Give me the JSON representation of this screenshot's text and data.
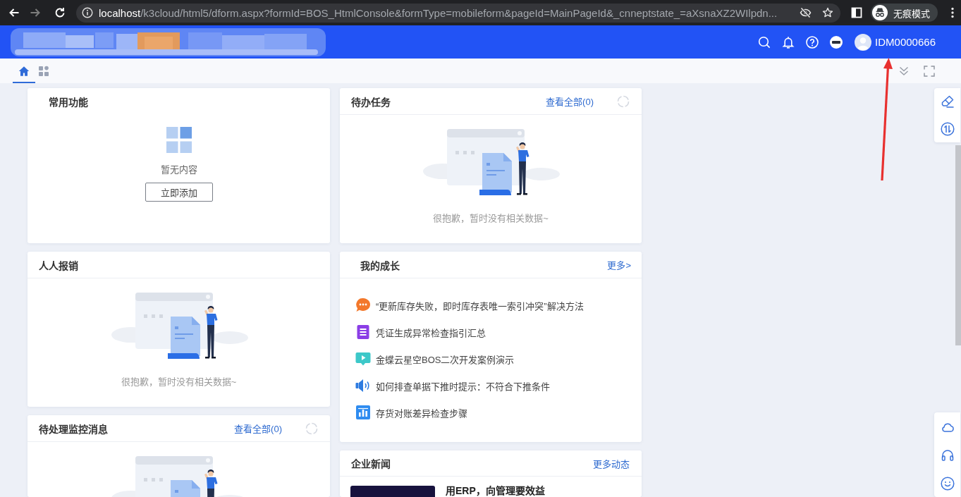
{
  "browser": {
    "address": {
      "host": "localhost",
      "path": "/k3cloud/html5/dform.aspx?formId=BOS_HtmlConsole&formType=mobileform&pageId=MainPageId&_cnneptstate_=aXsnaXZ2WIlpdn..."
    },
    "profile": "无痕模式"
  },
  "header": {
    "username": "IDM0000666"
  },
  "tabs": [
    {
      "kind": "home",
      "selected": true
    },
    {
      "kind": "apps",
      "selected": false
    }
  ],
  "columns": [
    {
      "cards": [
        {
          "kind": "shortcuts",
          "title": "常用功能",
          "loading": false,
          "empty_text": "暂无内容",
          "button": "立即添加"
        },
        {
          "kind": "empty",
          "title": "人人报销",
          "loading": false,
          "message": "很抱歉，暂时没有相关数据~"
        },
        {
          "kind": "empty",
          "title": "待处理监控消息",
          "link": "查看全部(0)",
          "loading": true
        }
      ]
    },
    {
      "cards": [
        {
          "kind": "empty",
          "title": "待办任务",
          "link": "查看全部(0)",
          "loading": true,
          "message": "很抱歉，暂时没有相关数据~"
        },
        {
          "kind": "list",
          "title": "我的成长",
          "link": "更多>",
          "loading": false,
          "items": [
            {
              "kind": "chat",
              "text": "“更新库存失败，即时库存表唯一索引冲突”解决方法"
            },
            {
              "kind": "document",
              "text": "凭证生成异常检查指引汇总"
            },
            {
              "kind": "video",
              "text": "金蝶云星空BOS二次开发案例演示"
            },
            {
              "kind": "audio",
              "text": "如何排查单据下推时提示：不符合下推条件"
            },
            {
              "kind": "chart",
              "text": "存货对账差异检查步骤"
            }
          ]
        },
        {
          "kind": "news",
          "title": "企业新闻",
          "link": "更多动态",
          "loading": false,
          "news": [
            {
              "headline": "用ERP，向管理要效益"
            }
          ]
        }
      ]
    }
  ]
}
